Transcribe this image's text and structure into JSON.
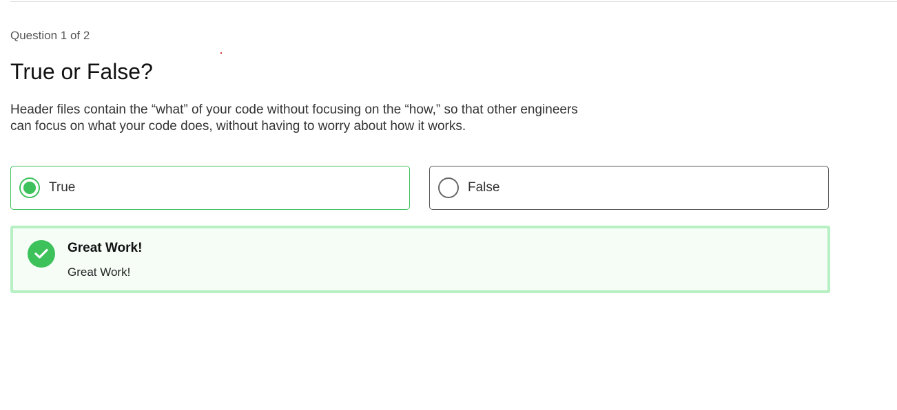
{
  "quiz": {
    "counter": "Question 1 of 2",
    "title": "True or False?",
    "prompt": "Header files contain the “what” of your code without focusing on the “how,” so that other engineers can focus on what your code does, without having to worry about how it works.",
    "options": [
      {
        "label": "True",
        "selected": true
      },
      {
        "label": "False",
        "selected": false
      }
    ]
  },
  "feedback": {
    "title": "Great Work!",
    "message": "Great Work!",
    "icon": "check-icon"
  },
  "colors": {
    "accent": "#3cc15b",
    "feedback_border": "#b7f0c3",
    "feedback_bg": "#f5fdf6"
  }
}
